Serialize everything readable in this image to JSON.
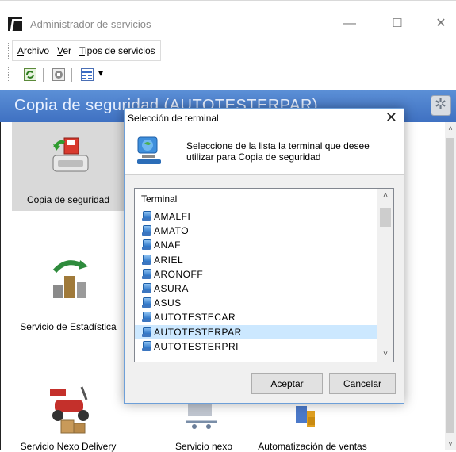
{
  "window": {
    "title": "Administrador de servicios",
    "minimize_glyph": "—",
    "maximize_glyph": "☐",
    "close_glyph": "✕"
  },
  "menu": {
    "items": [
      {
        "label": "Archivo",
        "mnemonic": "A",
        "rest": "rchivo"
      },
      {
        "label": "Ver",
        "mnemonic": "V",
        "rest": "er"
      },
      {
        "label": "Tipos de servicios",
        "mnemonic": "T",
        "rest": "ipos de servicios"
      }
    ]
  },
  "toolbar": {
    "icons": [
      "refresh-icon",
      "stop-icon",
      "view-mode-icon",
      "dropdown-arrow-icon"
    ],
    "dropdown_glyph": "▾"
  },
  "header": {
    "title": "Copia de seguridad (AUTOTESTERPAR)"
  },
  "tiles": [
    {
      "label": "Copia de seguridad",
      "icon": "backup-icon"
    },
    {
      "label": "Servicio de Estadística",
      "icon": "statistics-service-icon"
    },
    {
      "label": "Servicio Nexo Delivery",
      "icon": "delivery-scooter-icon"
    },
    {
      "label": "Servicio nexo",
      "icon": "nexo-service-icon"
    },
    {
      "label": "Automatización de ventas",
      "icon": "sales-automation-icon"
    }
  ],
  "dialog": {
    "title": "Selección de terminal",
    "close_glyph": "✕",
    "intro": "Seleccione de la lista la terminal que desee utilizar para Copia de seguridad",
    "list_header": "Terminal",
    "terminals": [
      "AMALFI",
      "AMATO",
      "ANAF",
      "ARIEL",
      "ARONOFF",
      "ASURA",
      "ASUS",
      "AUTOTESTECAR",
      "AUTOTESTERPAR",
      "AUTOTESTERPRI"
    ],
    "selected": "AUTOTESTERPAR",
    "accept_label": "Aceptar",
    "cancel_label": "Cancelar",
    "scroll_up_glyph": "˄",
    "scroll_down_glyph": "˅"
  },
  "colors": {
    "header_blue": "#4a7fcb",
    "selection": "#cce8ff",
    "dialog_border": "#6d9fd8"
  }
}
